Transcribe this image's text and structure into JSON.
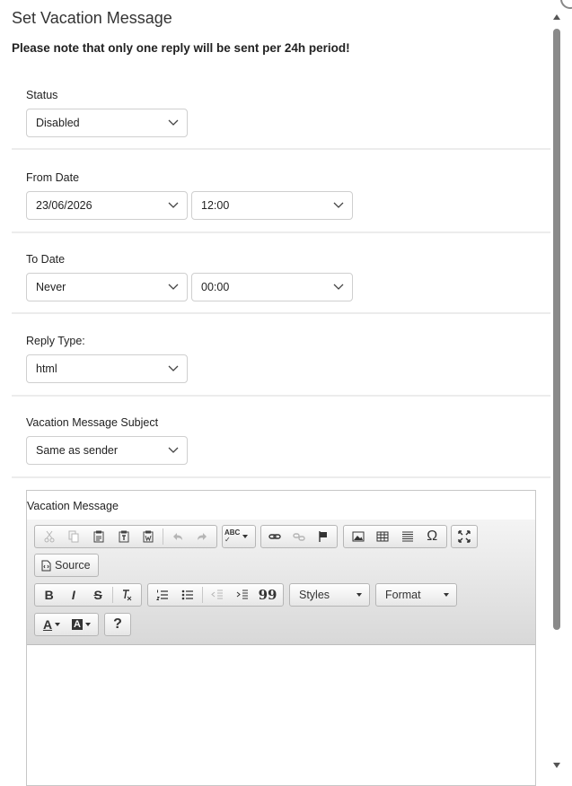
{
  "dialog": {
    "title": "Set Vacation Message",
    "notice": "Please note that only one reply will be sent per 24h period!"
  },
  "status": {
    "label": "Status",
    "value": "Disabled"
  },
  "from_date": {
    "label": "From Date",
    "date": "23/06/2026",
    "time": "12:00"
  },
  "to_date": {
    "label": "To Date",
    "date": "Never",
    "time": "00:00"
  },
  "reply_type": {
    "label": "Reply Type:",
    "value": "html"
  },
  "subject": {
    "label": "Vacation Message Subject",
    "value": "Same as sender"
  },
  "editor": {
    "label": "Vacation Message",
    "source_label": "Source",
    "styles_label": "Styles",
    "format_label": "Format",
    "strike_glyph": "S",
    "omega_glyph": "Ω",
    "help_glyph": "?",
    "quote_glyph": "99",
    "bold_glyph": "B",
    "italic_glyph": "I",
    "text_color_glyph": "A",
    "bg_color_glyph": "A",
    "spell_glyph": "ABC"
  },
  "icons": {
    "close": "close-icon",
    "dropdown": "chevron-down-icon",
    "cut": "cut-icon",
    "copy": "copy-icon",
    "paste": "paste-icon",
    "undo": "undo-icon",
    "redo": "redo-icon",
    "spellcheck": "spellcheck-icon",
    "link": "link-icon",
    "unlink": "unlink-icon",
    "anchor": "flag-icon",
    "image": "image-icon",
    "table": "table-icon",
    "hr": "horizontal-rule-icon",
    "special-char": "omega-icon",
    "maximize": "maximize-icon",
    "source": "source-icon"
  }
}
